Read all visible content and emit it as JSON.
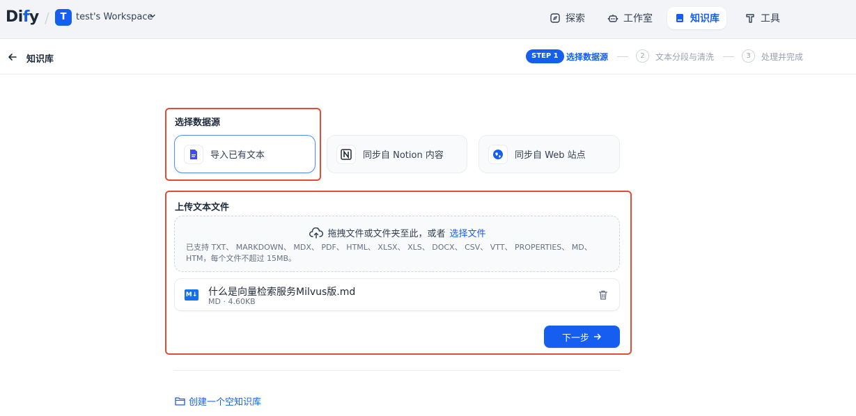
{
  "topbar": {
    "logo_main": "Di",
    "logo_accent": "f",
    "logo_tail": "y",
    "workspace_initial": "T",
    "workspace_name": "test's Workspace",
    "nav": [
      {
        "label": "探索",
        "icon": "compass-icon"
      },
      {
        "label": "工作室",
        "icon": "robot-icon"
      },
      {
        "label": "知识库",
        "icon": "book-icon",
        "active": true
      },
      {
        "label": "工具",
        "icon": "hammer-icon"
      }
    ]
  },
  "header": {
    "back_label": "知识库",
    "steps": [
      {
        "badge": "STEP 1",
        "label": "选择数据源"
      },
      {
        "num": "2",
        "label": "文本分段与清洗"
      },
      {
        "num": "3",
        "label": "处理并完成"
      }
    ]
  },
  "datasource": {
    "title": "选择数据源",
    "options": [
      {
        "label": "导入已有文本",
        "icon": "file-text-icon",
        "active": true
      },
      {
        "label": "同步自 Notion 内容",
        "icon": "notion-icon"
      },
      {
        "label": "同步自 Web 站点",
        "icon": "globe-icon"
      }
    ]
  },
  "upload": {
    "title": "上传文本文件",
    "drop_text": "拖拽文件或文件夹至此，或者",
    "drop_link": "选择文件",
    "support_text": "已支持 TXT、 MARKDOWN、 MDX、 PDF、 HTML、 XLSX、 XLS、 DOCX、 CSV、 VTT、 PROPERTIES、 MD、 HTM，每个文件不超过 15MB。",
    "file": {
      "badge": "M↓",
      "name": "什么是向量检索服务Milvus版.md",
      "meta": "MD · 4.60KB"
    },
    "next_label": "下一步"
  },
  "footer": {
    "create_empty_label": "创建一个空知识库"
  },
  "colors": {
    "accent": "#155eef",
    "highlight_border": "#e04c35"
  }
}
